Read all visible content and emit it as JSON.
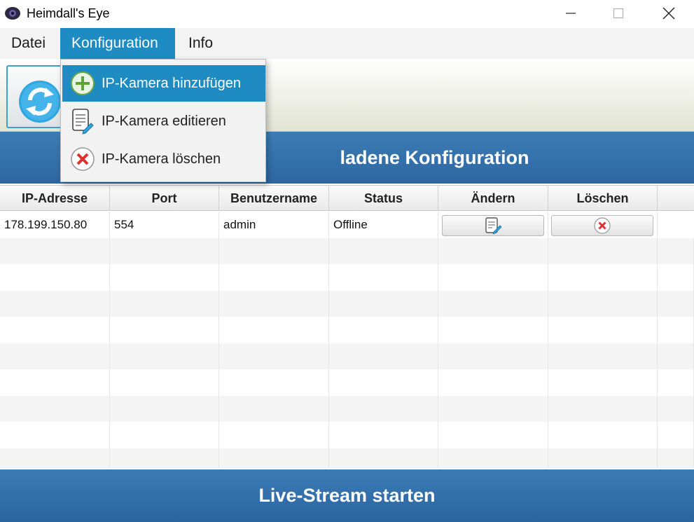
{
  "window": {
    "title": "Heimdall's Eye",
    "controls": {
      "minimize": "—",
      "maximize": "☐",
      "close": "✕"
    }
  },
  "menubar": {
    "items": [
      {
        "label": "Datei"
      },
      {
        "label": "Konfiguration",
        "state": "open"
      },
      {
        "label": "Info"
      }
    ]
  },
  "dropdown": {
    "items": [
      {
        "label": "IP-Kamera hinzufügen",
        "icon": "add-icon",
        "highlighted": true
      },
      {
        "label": "IP-Kamera editieren",
        "icon": "edit-document-icon"
      },
      {
        "label": "IP-Kamera löschen",
        "icon": "delete-icon"
      }
    ]
  },
  "toolbar": {
    "refresh_icon": "refresh-icon"
  },
  "header": {
    "title": "Geladene Konfiguration",
    "visible_text": "ladene Konfiguration"
  },
  "table": {
    "columns": [
      "IP-Adresse",
      "Port",
      "Benutzername",
      "Status",
      "Ändern",
      "Löschen"
    ],
    "rows": [
      {
        "ip": "178.199.150.80",
        "port": "554",
        "user": "admin",
        "status": "Offline"
      }
    ]
  },
  "live_button": {
    "label": "Live-Stream starten"
  },
  "colors": {
    "accent": "#1e8bc3",
    "header_blue": "#2f6ca8",
    "delete_red": "#e03030"
  }
}
